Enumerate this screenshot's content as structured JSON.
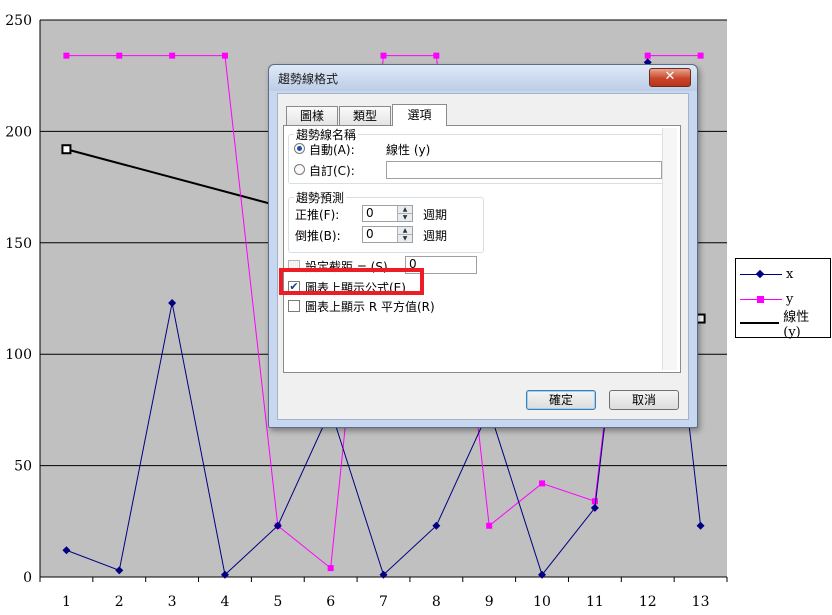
{
  "chart_data": {
    "type": "line",
    "categories": [
      "1",
      "2",
      "3",
      "4",
      "5",
      "6",
      "7",
      "8",
      "9",
      "10",
      "11",
      "12",
      "13"
    ],
    "ylim": [
      0,
      250
    ],
    "yticks": [
      "0",
      "50",
      "100",
      "150",
      "200",
      "250"
    ],
    "grid": true,
    "legend_position": "right",
    "series": [
      {
        "name": "x",
        "values": [
          12,
          3,
          123,
          1,
          23,
          75,
          1,
          23,
          75,
          1,
          31,
          231,
          23
        ]
      },
      {
        "name": "y",
        "values": [
          234,
          234,
          234,
          234,
          23,
          4,
          234,
          234,
          23,
          42,
          34,
          234,
          234
        ]
      },
      {
        "name": "線性 (y)",
        "values": [
          192,
          null,
          null,
          null,
          null,
          null,
          null,
          null,
          null,
          null,
          null,
          null,
          116
        ]
      }
    ],
    "colors": {
      "x": "#000080",
      "y": "#ff00ff",
      "trend": "#000000",
      "plot_bg": "#c0c0c0"
    }
  },
  "legend": {
    "items": [
      {
        "label": "x",
        "color": "#000080"
      },
      {
        "label": "y",
        "color": "#ff00ff"
      },
      {
        "label": "線性 (y)",
        "color": "#000000"
      }
    ]
  },
  "dialog": {
    "title": "趨勢線格式",
    "close_glyph": "✕",
    "tabs": [
      "圖樣",
      "類型",
      "選項"
    ],
    "active_tab": "選項",
    "name_group": {
      "title": "趨勢線名稱",
      "auto_label": "自動(A):",
      "auto_value": "線性 (y)",
      "custom_label": "自訂(C):",
      "custom_value": ""
    },
    "forecast_group": {
      "title": "趨勢預測",
      "forward_label": "正推(F):",
      "forward_value": "0",
      "forward_unit": "週期",
      "backward_label": "倒推(B):",
      "backward_value": "0",
      "backward_unit": "週期"
    },
    "intercept": {
      "label": "設定截距 = (S)",
      "value": "0",
      "checked": false
    },
    "show_equation": {
      "label": "圖表上顯示公式(E)",
      "checked": true
    },
    "show_r2": {
      "label": "圖表上顯示 R 平方值(R)",
      "checked": false
    },
    "ok_label": "確定",
    "cancel_label": "取消"
  }
}
